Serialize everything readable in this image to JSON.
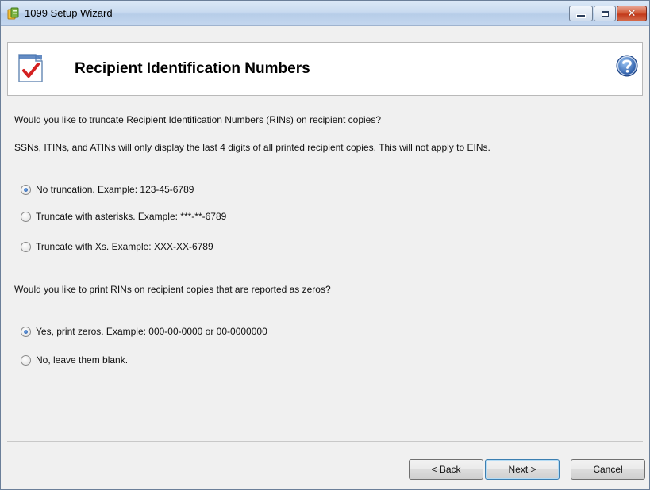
{
  "window": {
    "title": "1099 Setup Wizard",
    "icons": {
      "app": "1099-app-icon",
      "minimize": "minimize-icon",
      "maximize": "maximize-icon",
      "close": "close-icon"
    },
    "close_glyph": "✕"
  },
  "header": {
    "title": "Recipient Identification Numbers",
    "icon": "document-checkmark-icon",
    "help_icon": "help-question-icon"
  },
  "content": {
    "truncate_question": "Would you like to truncate Recipient Identification Numbers (RINs) on recipient copies?",
    "truncate_info": "SSNs, ITINs, and ATINs will only display the last 4 digits of all printed recipient copies. This will not apply to EINs.",
    "truncation_options": [
      {
        "label": "No truncation. Example: 123-45-6789",
        "checked": true
      },
      {
        "label": "Truncate with asterisks. Example: ***-**-6789",
        "checked": false
      },
      {
        "label": "Truncate with Xs. Example: XXX-XX-6789",
        "checked": false
      }
    ],
    "zeros_question": "Would you like to print RINs on recipient copies that are reported as zeros?",
    "zeros_options": [
      {
        "label": "Yes, print zeros. Example: 000-00-0000 or 00-0000000",
        "checked": true
      },
      {
        "label": "No, leave them blank.",
        "checked": false
      }
    ]
  },
  "buttons": {
    "back": "< Back",
    "next": "Next >",
    "cancel": "Cancel"
  },
  "colors": {
    "titlebar": "#c9dbf0",
    "close_button": "#c2391b",
    "help_icon": "#2a5fb0",
    "checkmark": "#d42020"
  }
}
